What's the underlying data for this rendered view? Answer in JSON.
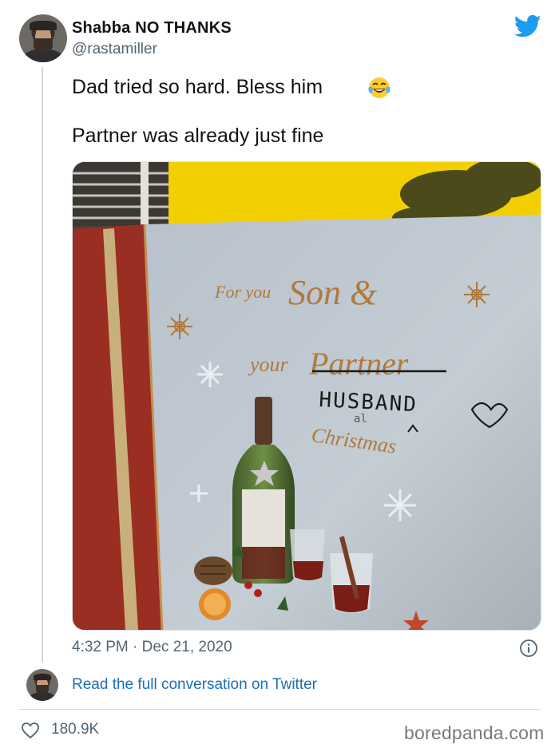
{
  "author": {
    "display_name": "Shabba NO THANKS",
    "handle": "@rastamiller"
  },
  "tweet": {
    "line1": "Dad tried so hard. Bless him",
    "line1_emoji": "face-with-tears-of-joy",
    "line2": "Partner was already just fine"
  },
  "card": {
    "printed_lines": [
      "For you",
      "Son &",
      "your",
      "Partner",
      "Christmas"
    ],
    "handwritten": [
      "HUSBAND",
      "al"
    ]
  },
  "meta": {
    "timestamp": "4:32 PM · Dec 21, 2020",
    "read_more": "Read the full conversation on Twitter",
    "likes": "180.9K"
  },
  "watermark": "boredpanda.com",
  "colors": {
    "twitter_blue": "#1d9bf0",
    "link_blue": "#1b6fb4",
    "secondary_text": "#536471",
    "card_wall_yellow": "#f2cf00",
    "card_red_border": "#9b2e22"
  }
}
